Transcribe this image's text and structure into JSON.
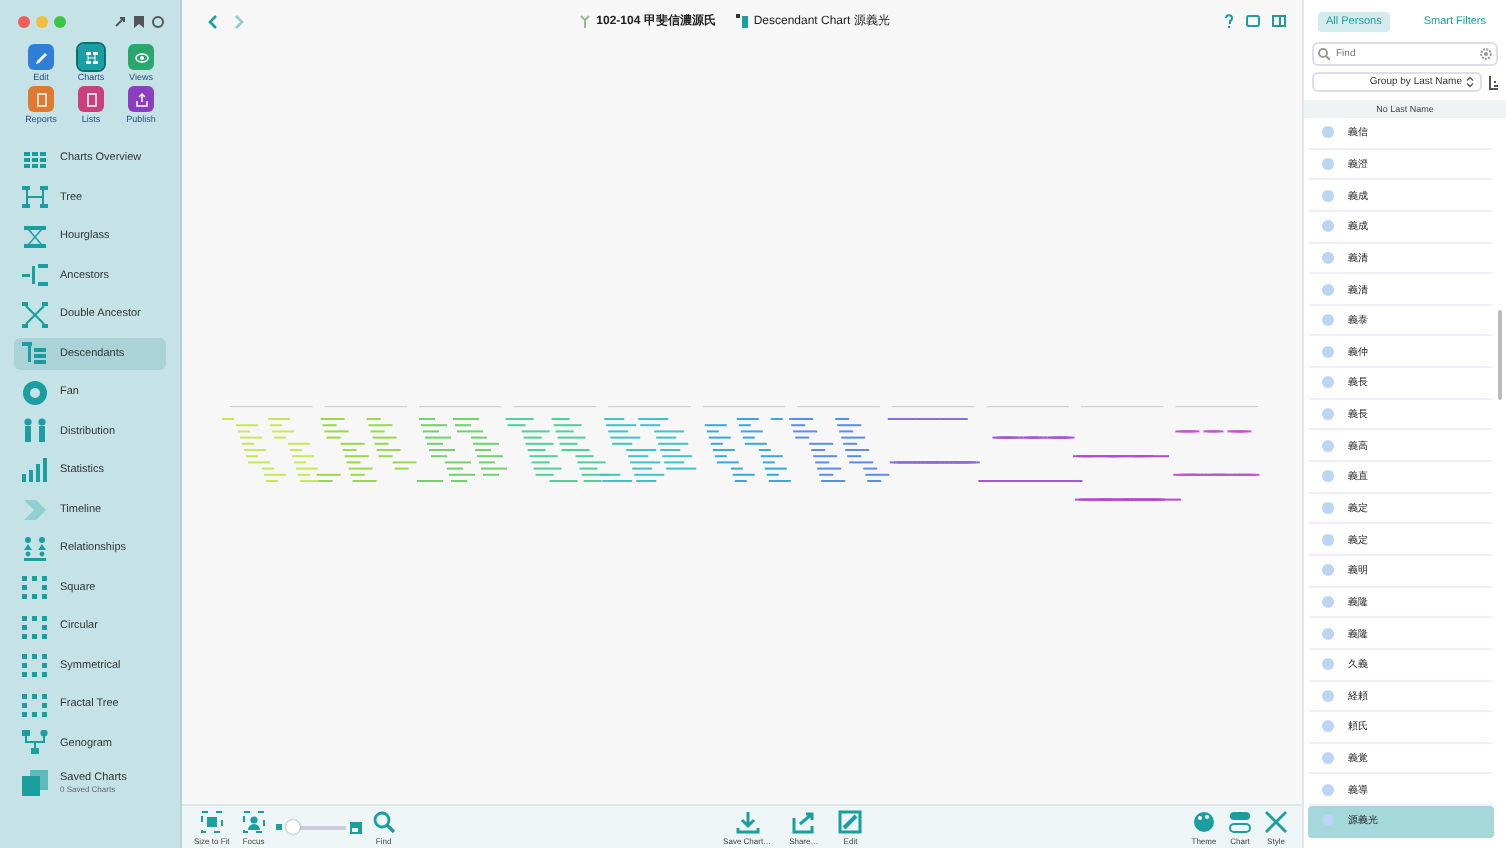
{
  "sidebar": {
    "actions": [
      {
        "label": "Edit",
        "kind": "edit",
        "selected": false
      },
      {
        "label": "Charts",
        "kind": "charts",
        "selected": true
      },
      {
        "label": "Views",
        "kind": "views",
        "selected": false
      },
      {
        "label": "Reports",
        "kind": "reports",
        "selected": false
      },
      {
        "label": "Lists",
        "kind": "lists",
        "selected": false
      },
      {
        "label": "Publish",
        "kind": "publish",
        "selected": false
      }
    ],
    "items": [
      {
        "label": "Charts Overview",
        "kind": "overview",
        "selected": false
      },
      {
        "label": "Tree",
        "kind": "tree",
        "selected": false
      },
      {
        "label": "Hourglass",
        "kind": "hourglass",
        "selected": false
      },
      {
        "label": "Ancestors",
        "kind": "ancestors",
        "selected": false
      },
      {
        "label": "Double Ancestor",
        "kind": "double",
        "selected": false
      },
      {
        "label": "Descendants",
        "kind": "descendants",
        "selected": true
      },
      {
        "label": "Fan",
        "kind": "fan",
        "selected": false
      },
      {
        "label": "Distribution",
        "kind": "distribution",
        "selected": false
      },
      {
        "label": "Statistics",
        "kind": "statistics",
        "selected": false
      },
      {
        "label": "Timeline",
        "kind": "timeline",
        "selected": false
      },
      {
        "label": "Relationships",
        "kind": "relationships",
        "selected": false
      },
      {
        "label": "Square",
        "kind": "dots",
        "selected": false
      },
      {
        "label": "Circular",
        "kind": "dots",
        "selected": false
      },
      {
        "label": "Symmetrical",
        "kind": "dots",
        "selected": false
      },
      {
        "label": "Fractal Tree",
        "kind": "dots",
        "selected": false
      },
      {
        "label": "Genogram",
        "kind": "genogram",
        "selected": false
      },
      {
        "label": "Saved Charts",
        "kind": "saved",
        "selected": false,
        "subtitle": "0 Saved Charts"
      }
    ]
  },
  "toolbar": {
    "person": "102-104 甲斐信濃源氏",
    "chart_title": "Descendant Chart 源義光"
  },
  "bottom_bar": {
    "left": [
      {
        "label": "Size to Fit",
        "kind": "fit"
      },
      {
        "label": "Focus",
        "kind": "focus"
      }
    ],
    "zoom": {
      "level": 0.12
    },
    "find": {
      "label": "Find",
      "kind": "find"
    },
    "center": [
      {
        "label": "Save Chart…",
        "kind": "save"
      },
      {
        "label": "Share…",
        "kind": "share"
      },
      {
        "label": "Edit",
        "kind": "edit"
      }
    ],
    "right": [
      {
        "label": "Theme",
        "kind": "theme"
      },
      {
        "label": "Chart",
        "kind": "chart"
      },
      {
        "label": "Style",
        "kind": "style"
      }
    ]
  },
  "persons_panel": {
    "tabs": [
      {
        "label": "All Persons",
        "selected": true
      },
      {
        "label": "Smart Filters",
        "selected": false
      }
    ],
    "search": {
      "placeholder": "Find"
    },
    "group_by": "Group by Last Name",
    "section": "No Last Name",
    "persons": [
      {
        "name": "義信",
        "selected": false
      },
      {
        "name": "義澄",
        "selected": false
      },
      {
        "name": "義成",
        "selected": false
      },
      {
        "name": "義成",
        "selected": false
      },
      {
        "name": "義清",
        "selected": false
      },
      {
        "name": "義清",
        "selected": false
      },
      {
        "name": "義泰",
        "selected": false
      },
      {
        "name": "義仲",
        "selected": false
      },
      {
        "name": "義長",
        "selected": false
      },
      {
        "name": "義長",
        "selected": false
      },
      {
        "name": "義高",
        "selected": false
      },
      {
        "name": "義直",
        "selected": false
      },
      {
        "name": "義定",
        "selected": false
      },
      {
        "name": "義定",
        "selected": false
      },
      {
        "name": "義明",
        "selected": false
      },
      {
        "name": "義隆",
        "selected": false
      },
      {
        "name": "義隆",
        "selected": false
      },
      {
        "name": "久義",
        "selected": false
      },
      {
        "name": "経頼",
        "selected": false
      },
      {
        "name": "頼氏",
        "selected": false
      },
      {
        "name": "義覚",
        "selected": false
      },
      {
        "name": "義導",
        "selected": false
      },
      {
        "name": "源義光",
        "selected": true
      }
    ]
  }
}
